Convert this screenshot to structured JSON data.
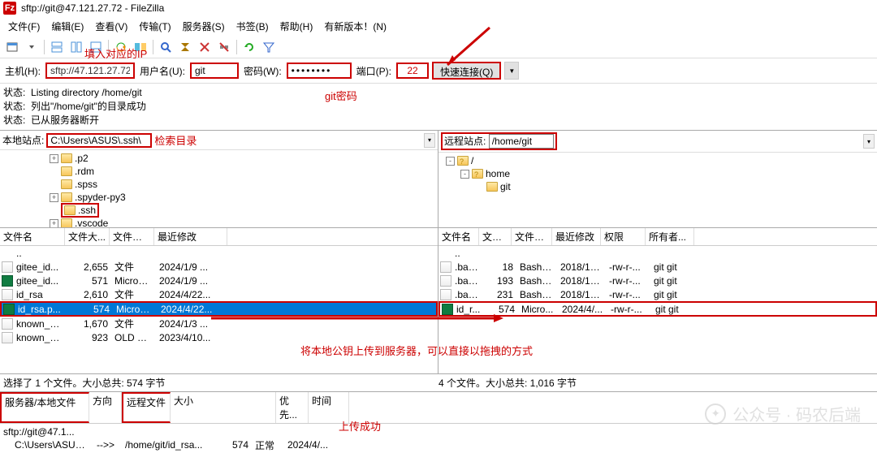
{
  "window": {
    "title": "sftp://git@47.121.27.72 - FileZilla"
  },
  "menu": {
    "file": "文件(F)",
    "edit": "编辑(E)",
    "view": "查看(V)",
    "transfer": "传输(T)",
    "server": "服务器(S)",
    "bookmarks": "书签(B)",
    "help": "帮助(H)",
    "newver": "有新版本！(N)"
  },
  "quickconnect": {
    "host_label": "主机(H):",
    "host": "sftp://47.121.27.72",
    "user_label": "用户名(U):",
    "user": "git",
    "pass_label": "密码(W):",
    "pass": "••••••••",
    "port_label": "端口(P):",
    "port": "22",
    "connect_btn": "快速连接(Q)"
  },
  "status": {
    "prefix": "状态:",
    "l1": "Listing directory /home/git",
    "l2": "列出\"/home/git\"的目录成功",
    "l3": "已从服务器断开"
  },
  "localsite": {
    "label": "本地站点:",
    "path": "C:\\Users\\ASUS\\.ssh\\",
    "tree": [
      {
        "indent": 4,
        "exp": "+",
        "name": ".p2"
      },
      {
        "indent": 4,
        "exp": "",
        "name": ".rdm"
      },
      {
        "indent": 4,
        "exp": "",
        "name": ".spss"
      },
      {
        "indent": 4,
        "exp": "+",
        "name": ".spyder-py3"
      },
      {
        "indent": 4,
        "exp": "",
        "name": ".ssh",
        "hl": true
      },
      {
        "indent": 4,
        "exp": "+",
        "name": ".vscode"
      }
    ]
  },
  "remotesite": {
    "label": "远程站点:",
    "path": "/home/git",
    "tree": [
      {
        "indent": 0,
        "exp": "-",
        "name": "/",
        "q": true
      },
      {
        "indent": 1,
        "exp": "-",
        "name": "home",
        "q": true
      },
      {
        "indent": 2,
        "exp": "",
        "name": "git"
      }
    ]
  },
  "cols_local": {
    "name": "文件名",
    "size": "文件大...",
    "type": "文件类型",
    "mod": "最近修改"
  },
  "cols_remote": {
    "name": "文件名",
    "size": "文件...",
    "type": "文件类...",
    "mod": "最近修改",
    "perm": "权限",
    "own": "所有者..."
  },
  "local_files": [
    {
      "name": "..",
      "size": "",
      "type": "",
      "mod": "",
      "icon": "folderup"
    },
    {
      "name": "gitee_id...",
      "size": "2,655",
      "type": "文件",
      "mod": "2024/1/9 ...",
      "icon": "doc"
    },
    {
      "name": "gitee_id...",
      "size": "571",
      "type": "Microsof...",
      "mod": "2024/1/9 ...",
      "icon": "ms"
    },
    {
      "name": "id_rsa",
      "size": "2,610",
      "type": "文件",
      "mod": "2024/4/22...",
      "icon": "doc"
    },
    {
      "name": "id_rsa.p...",
      "size": "574",
      "type": "Microsof...",
      "mod": "2024/4/22...",
      "icon": "ms",
      "selected": true
    },
    {
      "name": "known_h...",
      "size": "1,670",
      "type": "文件",
      "mod": "2024/1/3 ...",
      "icon": "doc"
    },
    {
      "name": "known_h...",
      "size": "923",
      "type": "OLD 文件",
      "mod": "2023/4/10...",
      "icon": "doc"
    }
  ],
  "remote_files": [
    {
      "name": "..",
      "size": "",
      "type": "",
      "mod": "",
      "perm": "",
      "own": "",
      "icon": "folderup"
    },
    {
      "name": ".bas...",
      "size": "18",
      "type": "Bash L...",
      "mod": "2018/10...",
      "perm": "-rw-r-...",
      "own": "git git",
      "icon": "doc"
    },
    {
      "name": ".bas...",
      "size": "193",
      "type": "Bash P...",
      "mod": "2018/10...",
      "perm": "-rw-r-...",
      "own": "git git",
      "icon": "doc"
    },
    {
      "name": ".bas...",
      "size": "231",
      "type": "Bash P...",
      "mod": "2018/10...",
      "perm": "-rw-r-...",
      "own": "git git",
      "icon": "doc"
    },
    {
      "name": "id_r...",
      "size": "574",
      "type": "Micro...",
      "mod": "2024/4/...",
      "perm": "-rw-r-...",
      "own": "git git",
      "icon": "ms",
      "boxed": true
    }
  ],
  "local_status": "选择了 1 个文件。大小总共: 574 字节",
  "remote_status": "4 个文件。大小总共: 1,016 字节",
  "queue": {
    "cols": {
      "srv": "服务器/本地文件",
      "dir": "方向",
      "remote": "远程文件",
      "size": "大小",
      "prio": "优先...",
      "time": "时间"
    },
    "server_row": "sftp://git@47.1...",
    "row": {
      "local": "C:\\Users\\ASUS...",
      "dir": "-->>",
      "remote": "/home/git/id_rsa...",
      "size": "574",
      "status": "正常",
      "time": "2024/4/..."
    }
  },
  "ann": {
    "ip_hint": "填入对应的IP",
    "gitpwd": "git密码",
    "treesearch": "检索目录",
    "dragtip": "将本地公钥上传到服务器，可以直接以拖拽的方式",
    "success": "上传成功"
  },
  "watermark": "公众号 · 码农后端"
}
